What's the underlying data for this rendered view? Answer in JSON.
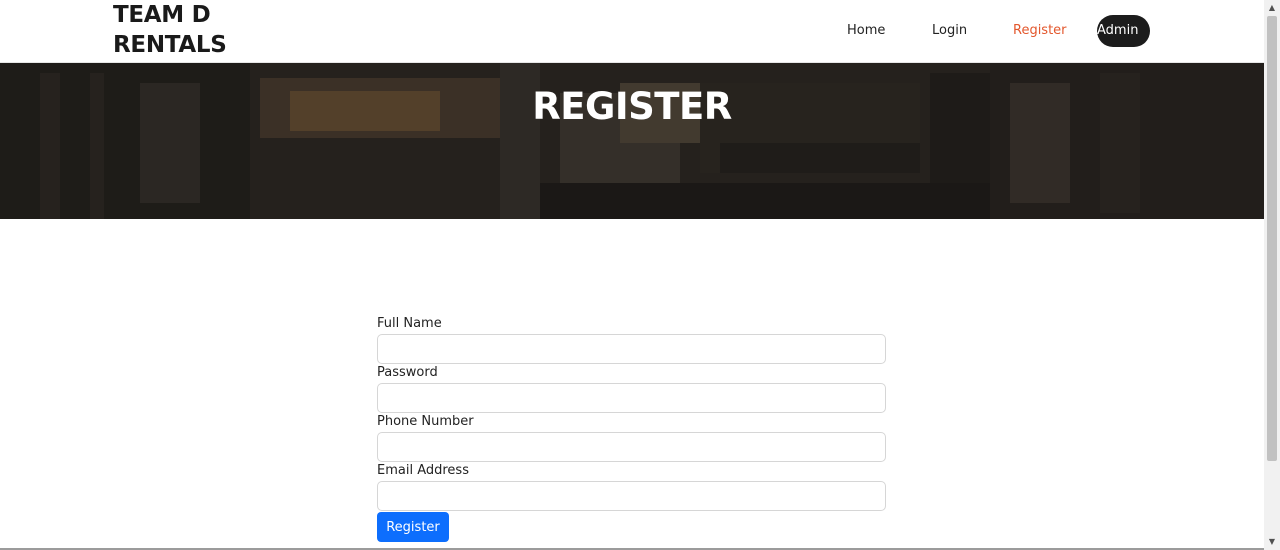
{
  "brand": {
    "line1": "TEAM D",
    "line2": "RENTALS"
  },
  "nav": {
    "home": "Home",
    "login": "Login",
    "register": "Register",
    "admin": "Admin",
    "active_color": "#e3572c"
  },
  "hero": {
    "title": "REGISTER"
  },
  "form": {
    "full_name_label": "Full Name",
    "full_name_value": "",
    "password_label": "Password",
    "password_value": "",
    "phone_label": "Phone Number",
    "phone_value": "",
    "email_label": "Email Address",
    "email_value": "",
    "submit_label": "Register",
    "submit_color": "#0d6efd"
  },
  "icons": {
    "scroll_up": "triangle-up-icon",
    "scroll_down": "triangle-down-icon"
  }
}
